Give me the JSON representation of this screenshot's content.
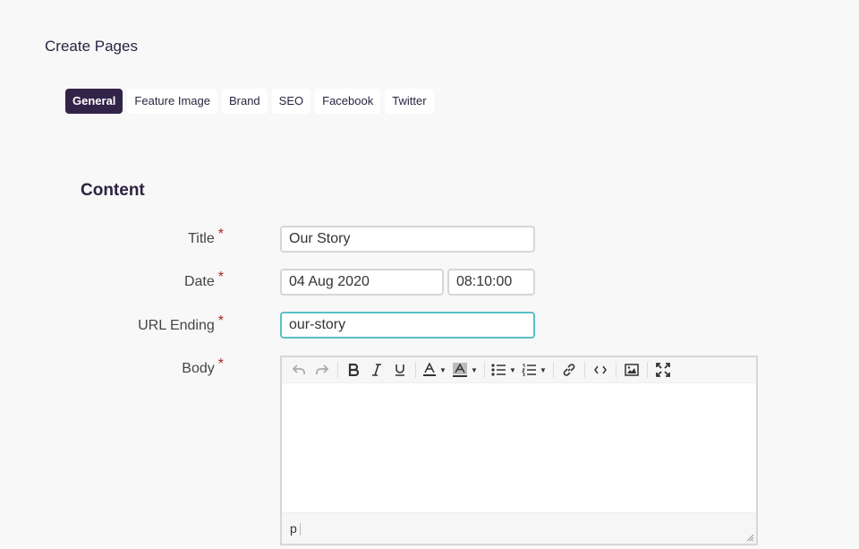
{
  "page": {
    "title": "Create Pages"
  },
  "tabs": [
    {
      "label": "General",
      "active": true
    },
    {
      "label": "Feature Image"
    },
    {
      "label": "Brand"
    },
    {
      "label": "SEO"
    },
    {
      "label": "Facebook"
    },
    {
      "label": "Twitter"
    }
  ],
  "section": {
    "heading": "Content"
  },
  "form": {
    "required_marker": "*",
    "title": {
      "label": "Title",
      "value": "Our Story"
    },
    "date": {
      "label": "Date",
      "date_value": "04 Aug 2020",
      "time_value": "08:10:00"
    },
    "url": {
      "label": "URL Ending",
      "value": "our-story"
    },
    "body": {
      "label": "Body",
      "path": "p"
    }
  },
  "colors": {
    "accent": "#322348",
    "required": "#a8271b",
    "focus": "#5bbfc7"
  },
  "toolbar_icons": [
    "undo-icon",
    "redo-icon",
    "bold-icon",
    "italic-icon",
    "underline-icon",
    "text-color-icon",
    "background-color-icon",
    "bullet-list-icon",
    "numbered-list-icon",
    "link-icon",
    "code-icon",
    "image-icon",
    "fullscreen-icon"
  ]
}
